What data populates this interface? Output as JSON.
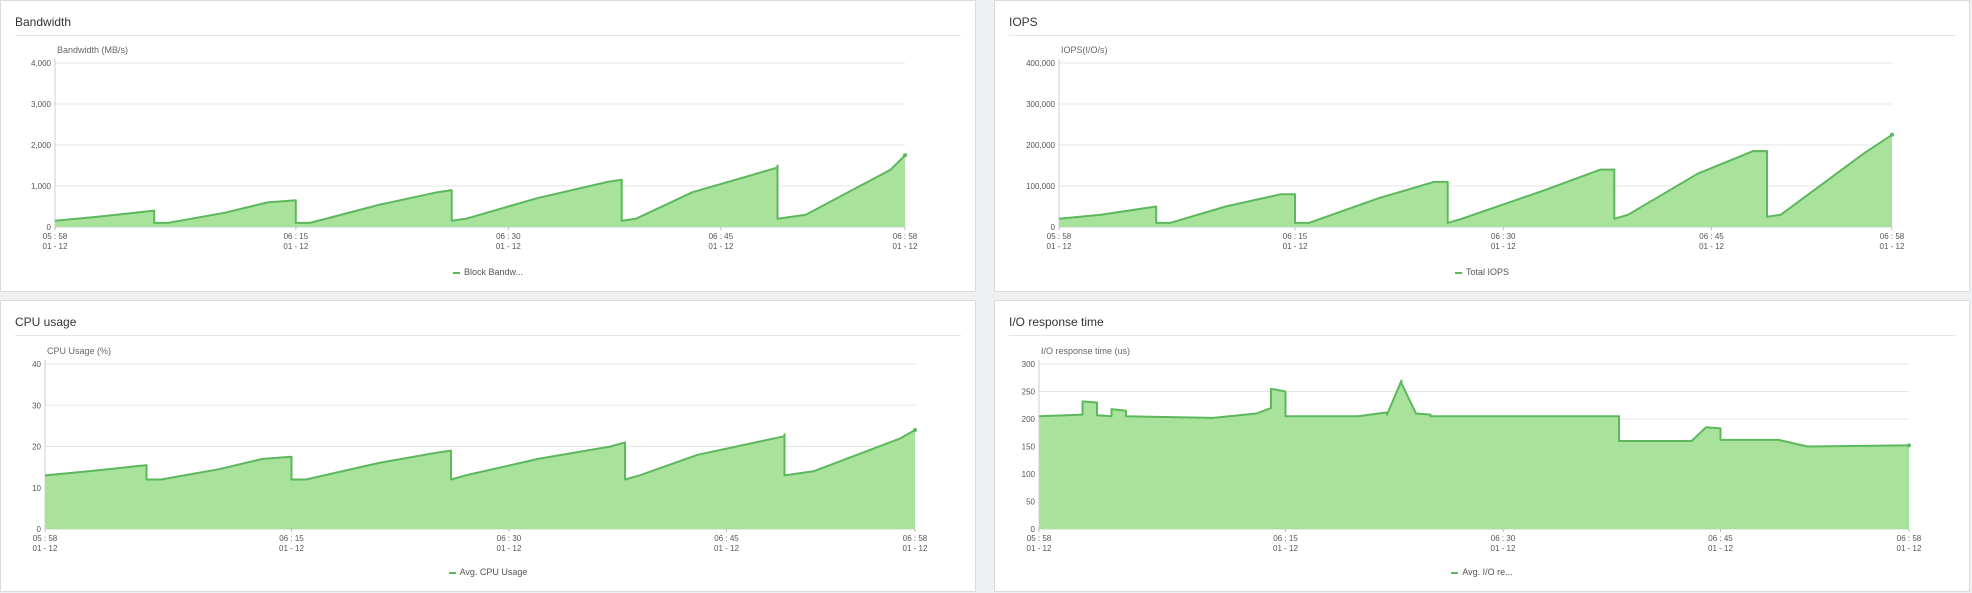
{
  "style": {
    "line_color": "#5cb85c",
    "fill_color": "#a8e29b",
    "grid_color": "#e5e5e5"
  },
  "panels": [
    {
      "title": "Bandwidth",
      "legend": "Block Bandw..."
    },
    {
      "title": "IOPS",
      "legend": "Total IOPS"
    },
    {
      "title": "CPU usage",
      "legend": "Avg. CPU Usage"
    },
    {
      "title": "I/O response time",
      "legend": "Avg. I/O re..."
    }
  ],
  "chart_data": [
    {
      "type": "area",
      "title": "Bandwidth",
      "ylabel": "Bandwidth (MB/s)",
      "ylim": [
        0,
        4000
      ],
      "yticks": [
        0,
        1000,
        2000,
        3000,
        4000
      ],
      "ytick_labels": [
        "0",
        "1,000",
        "2,000",
        "3,000",
        "4,000"
      ],
      "xlim": [
        "05:58",
        "06:58"
      ],
      "xticks": [
        {
          "time": "05:58",
          "time_label": "05 : 58",
          "date_label": "01 - 12"
        },
        {
          "time": "06:15",
          "time_label": "06 : 15",
          "date_label": "01 - 12"
        },
        {
          "time": "06:30",
          "time_label": "06 : 30",
          "date_label": "01 - 12"
        },
        {
          "time": "06:45",
          "time_label": "06 : 45",
          "date_label": "01 - 12"
        },
        {
          "time": "06:58",
          "time_label": "06 : 58",
          "date_label": "01 - 12"
        }
      ],
      "grid": true,
      "legend_position": "bottom-center",
      "series": [
        {
          "name": "Block Bandw...",
          "x": [
            "05:58",
            "06:01",
            "06:05",
            "06:05",
            "06:06",
            "06:10",
            "06:13",
            "06:15",
            "06:15",
            "06:16",
            "06:21",
            "06:25",
            "06:26",
            "06:26",
            "06:27",
            "06:32",
            "06:37",
            "06:38",
            "06:38",
            "06:39",
            "06:43",
            "06:49",
            "06:49",
            "06:49",
            "06:51",
            "06:57",
            "06:58"
          ],
          "y": [
            150,
            250,
            400,
            100,
            100,
            350,
            600,
            650,
            100,
            100,
            550,
            850,
            900,
            150,
            200,
            700,
            1100,
            1150,
            150,
            200,
            850,
            1450,
            1500,
            200,
            300,
            1400,
            1750
          ]
        }
      ]
    },
    {
      "type": "area",
      "title": "IOPS",
      "ylabel": "IOPS(I/O/s)",
      "ylim": [
        0,
        400000
      ],
      "yticks": [
        0,
        100000,
        200000,
        300000,
        400000
      ],
      "ytick_labels": [
        "0",
        "100,000",
        "200,000",
        "300,000",
        "400,000"
      ],
      "xlim": [
        "05:58",
        "06:58"
      ],
      "xticks": [
        {
          "time": "05:58",
          "time_label": "05 : 58",
          "date_label": "01 - 12"
        },
        {
          "time": "06:15",
          "time_label": "06 : 15",
          "date_label": "01 - 12"
        },
        {
          "time": "06:30",
          "time_label": "06 : 30",
          "date_label": "01 - 12"
        },
        {
          "time": "06:45",
          "time_label": "06 : 45",
          "date_label": "01 - 12"
        },
        {
          "time": "06:58",
          "time_label": "06 : 58",
          "date_label": "01 - 12"
        }
      ],
      "grid": true,
      "legend_position": "bottom-center",
      "series": [
        {
          "name": "Total IOPS",
          "x": [
            "05:58",
            "06:01",
            "06:05",
            "06:05",
            "06:06",
            "06:10",
            "06:14",
            "06:15",
            "06:15",
            "06:16",
            "06:21",
            "06:25",
            "06:26",
            "06:26",
            "06:27",
            "06:33",
            "06:37",
            "06:38",
            "06:38",
            "06:39",
            "06:44",
            "06:48",
            "06:49",
            "06:49",
            "06:50",
            "06:56",
            "06:58"
          ],
          "y": [
            20000,
            30000,
            50000,
            10000,
            10000,
            50000,
            80000,
            80000,
            10000,
            10000,
            70000,
            110000,
            110000,
            10000,
            20000,
            90000,
            140000,
            140000,
            20000,
            30000,
            130000,
            185000,
            185000,
            25000,
            30000,
            180000,
            225000
          ]
        }
      ]
    },
    {
      "type": "area",
      "title": "CPU usage",
      "ylabel": "CPU Usage (%)",
      "ylim": [
        0,
        40
      ],
      "yticks": [
        0,
        10,
        20,
        30,
        40
      ],
      "ytick_labels": [
        "0",
        "10",
        "20",
        "30",
        "40"
      ],
      "xlim": [
        "05:58",
        "06:58"
      ],
      "xticks": [
        {
          "time": "05:58",
          "time_label": "05 : 58",
          "date_label": "01 - 12"
        },
        {
          "time": "06:15",
          "time_label": "06 : 15",
          "date_label": "01 - 12"
        },
        {
          "time": "06:30",
          "time_label": "06 : 30",
          "date_label": "01 - 12"
        },
        {
          "time": "06:45",
          "time_label": "06 : 45",
          "date_label": "01 - 12"
        },
        {
          "time": "06:58",
          "time_label": "06 : 58",
          "date_label": "01 - 12"
        }
      ],
      "grid": true,
      "legend_position": "bottom-center",
      "series": [
        {
          "name": "Avg. CPU Usage",
          "x": [
            "05:58",
            "06:01",
            "06:05",
            "06:05",
            "06:06",
            "06:10",
            "06:13",
            "06:15",
            "06:15",
            "06:16",
            "06:21",
            "06:25",
            "06:26",
            "06:26",
            "06:27",
            "06:32",
            "06:37",
            "06:38",
            "06:38",
            "06:39",
            "06:43",
            "06:49",
            "06:49",
            "06:49",
            "06:51",
            "06:57",
            "06:58"
          ],
          "y": [
            13,
            14,
            15.5,
            12,
            12,
            14.5,
            17,
            17.5,
            12,
            12,
            16,
            18.5,
            19,
            12,
            13,
            17,
            20,
            21,
            12,
            13,
            18,
            22.5,
            23,
            13,
            14,
            22,
            24
          ]
        }
      ]
    },
    {
      "type": "area",
      "title": "I/O response time",
      "ylabel": "I/O response time (us)",
      "ylim": [
        0,
        300
      ],
      "yticks": [
        0,
        50,
        100,
        150,
        200,
        250,
        300
      ],
      "ytick_labels": [
        "0",
        "50",
        "100",
        "150",
        "200",
        "250",
        "300"
      ],
      "xlim": [
        "05:58",
        "06:58"
      ],
      "xticks": [
        {
          "time": "05:58",
          "time_label": "05 : 58",
          "date_label": "01 - 12"
        },
        {
          "time": "06:15",
          "time_label": "06 : 15",
          "date_label": "01 - 12"
        },
        {
          "time": "06:30",
          "time_label": "06 : 30",
          "date_label": "01 - 12"
        },
        {
          "time": "06:45",
          "time_label": "06 : 45",
          "date_label": "01 - 12"
        },
        {
          "time": "06:58",
          "time_label": "06 : 58",
          "date_label": "01 - 12"
        }
      ],
      "grid": true,
      "legend_position": "bottom-center",
      "series": [
        {
          "name": "Avg. I/O re...",
          "x": [
            "05:58",
            "06:01",
            "06:01",
            "06:02",
            "06:02",
            "06:03",
            "06:03",
            "06:04",
            "06:04",
            "06:10",
            "06:13",
            "06:14",
            "06:14",
            "06:15",
            "06:15",
            "06:20",
            "06:22",
            "06:22",
            "06:23",
            "06:23",
            "06:24",
            "06:25",
            "06:25",
            "06:38",
            "06:38",
            "06:43",
            "06:44",
            "06:45",
            "06:45",
            "06:49",
            "06:51",
            "06:58"
          ],
          "y": [
            205,
            208,
            232,
            230,
            207,
            205,
            218,
            215,
            205,
            202,
            210,
            220,
            255,
            250,
            205,
            205,
            212,
            208,
            270,
            265,
            210,
            208,
            205,
            205,
            160,
            160,
            185,
            183,
            162,
            162,
            150,
            152
          ]
        }
      ]
    }
  ]
}
